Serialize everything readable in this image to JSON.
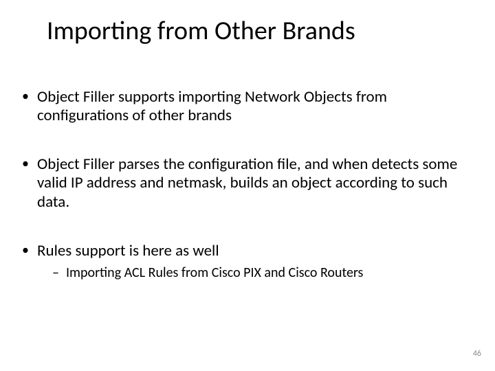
{
  "title": "Importing from Other Brands",
  "bullets": {
    "b1": "Object Filler supports importing Network Objects from configurations of other brands",
    "b2": "Object Filler parses the configuration file, and when detects some valid IP address and netmask, builds an object according to such data.",
    "b3": "Rules support is here as well",
    "b3_sub1": "Importing ACL Rules from Cisco PIX and Cisco Routers"
  },
  "page_number": "46"
}
